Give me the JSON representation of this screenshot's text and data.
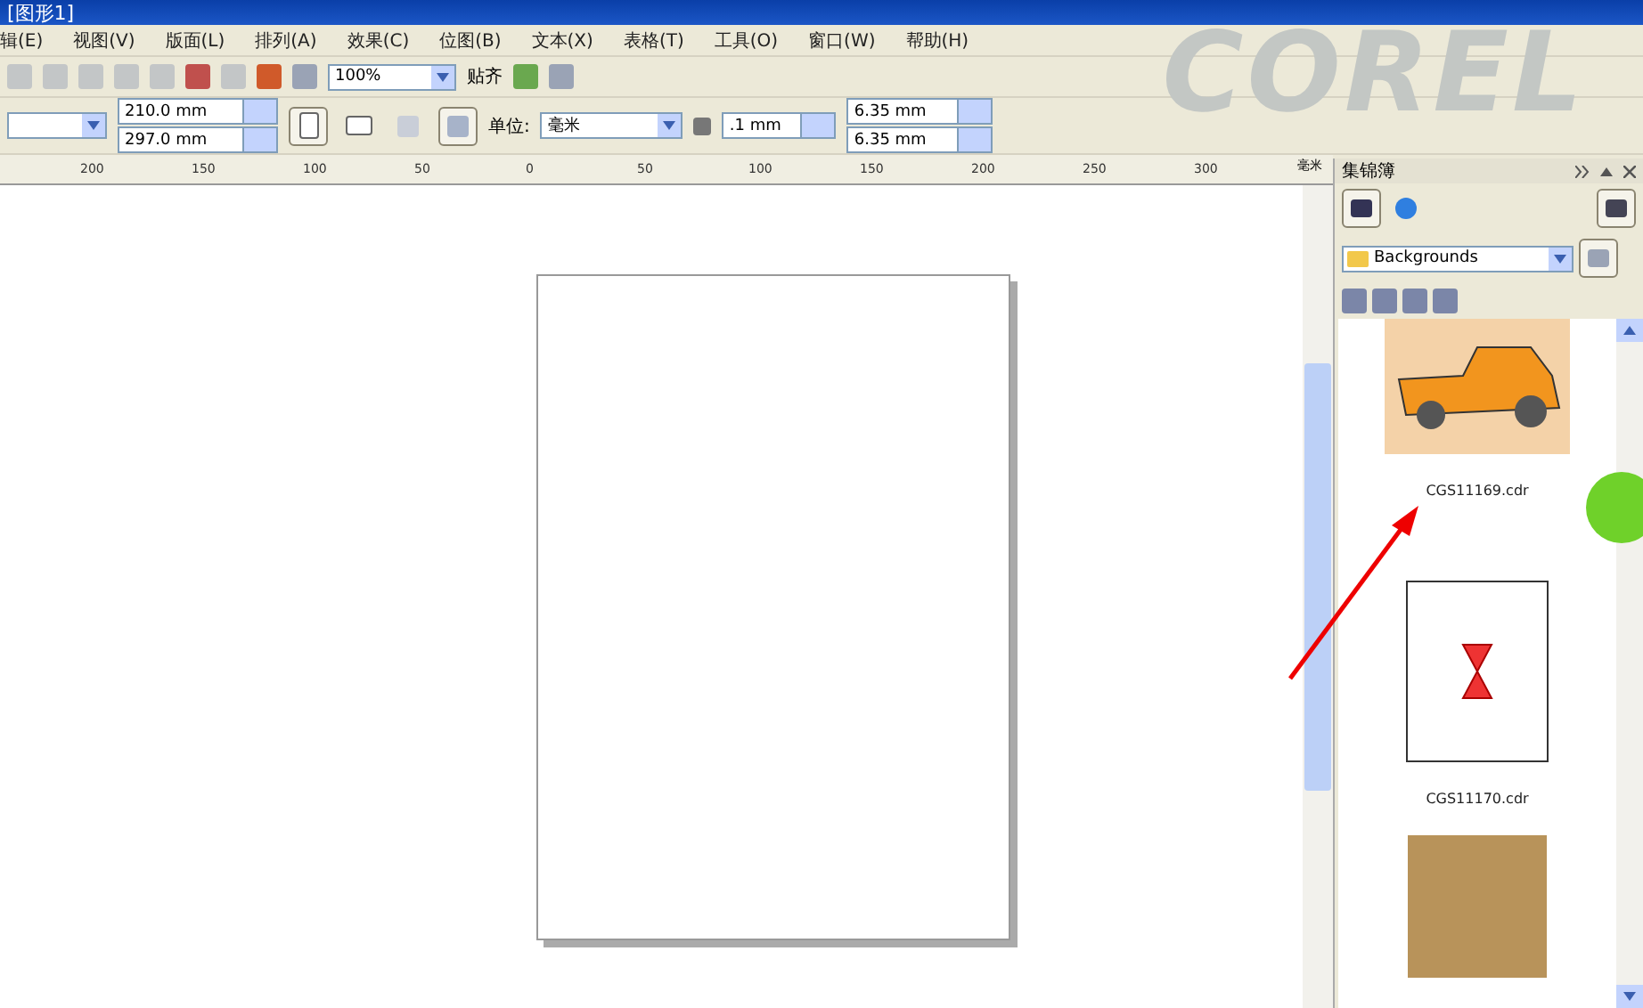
{
  "window": {
    "title": "[图形1]"
  },
  "menu": [
    "辑(E)",
    "视图(V)",
    "版面(L)",
    "排列(A)",
    "效果(C)",
    "位图(B)",
    "文本(X)",
    "表格(T)",
    "工具(O)",
    "窗口(W)",
    "帮助(H)"
  ],
  "toolbar": {
    "zoom": "100%",
    "snap": "贴齐"
  },
  "property_bar": {
    "width": "210.0 mm",
    "height": "297.0 mm",
    "orientation": [
      {
        "kind": "portrait",
        "selected": true
      },
      {
        "kind": "landscape",
        "selected": false
      }
    ],
    "page_scope": [
      {
        "kind": "all",
        "selected": false
      },
      {
        "kind": "current",
        "selected": true
      }
    ],
    "unit_label": "单位:",
    "unit": "毫米",
    "nudge": ".1 mm",
    "duplicate_x": "6.35 mm",
    "duplicate_y": "6.35 mm"
  },
  "logo": "COREL",
  "ruler": {
    "ticks": [
      "200",
      "150",
      "100",
      "50",
      "0",
      "50",
      "100",
      "150",
      "200",
      "250",
      "300"
    ],
    "unit": "毫米"
  },
  "docker": {
    "title": "集锦簿",
    "folder": "Backgrounds",
    "items": [
      {
        "kind": "image",
        "label": "CGS11169.cdr"
      },
      {
        "kind": "file",
        "label": "CGS11170.cdr"
      },
      {
        "kind": "photo"
      }
    ]
  }
}
